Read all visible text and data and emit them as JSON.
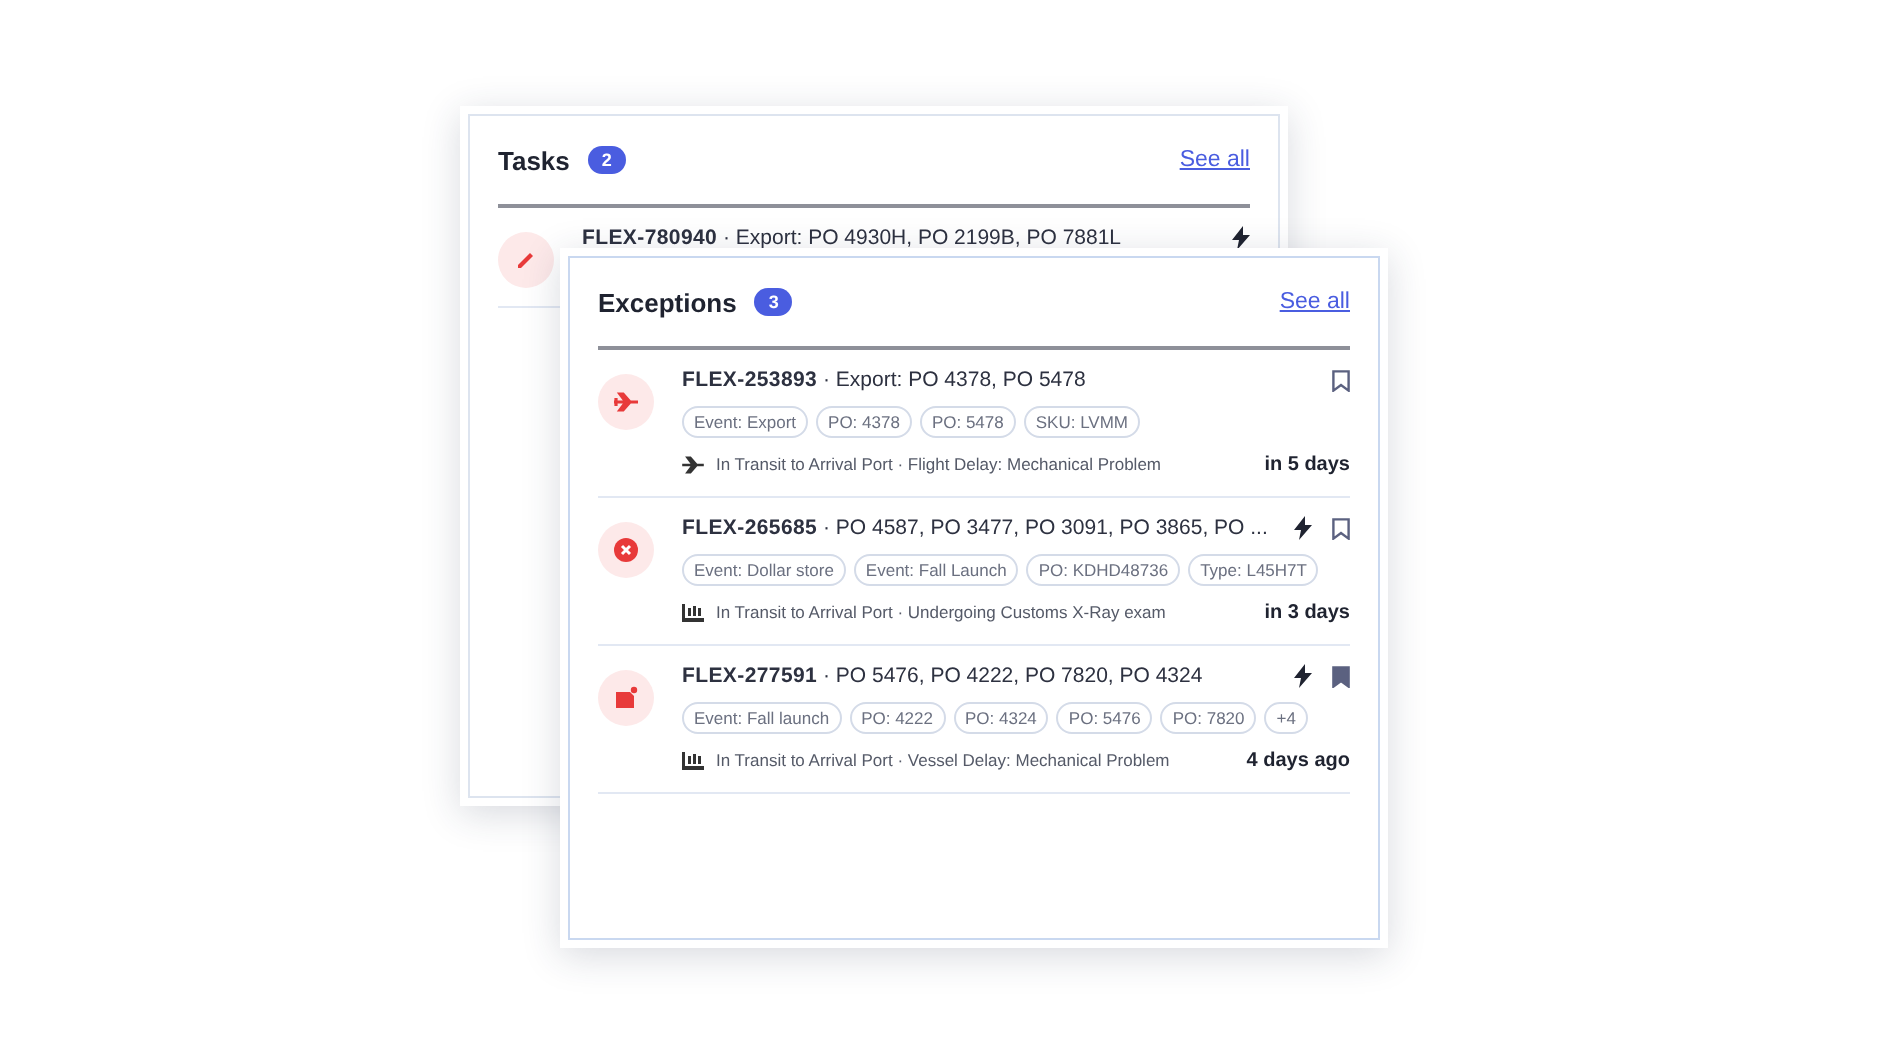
{
  "tasks": {
    "title": "Tasks",
    "count": "2",
    "link": "See all",
    "rows": [
      {
        "kind": "pencil",
        "title": "**FLEX-780940** · Export: PO 4930H, PO 2199B, PO 7881L",
        "urgent": true
      }
    ]
  },
  "exceptions": {
    "title": "Exceptions",
    "count": "3",
    "link": "See all",
    "rows": [
      {
        "kind": "plane",
        "title": "**FLEX-253893** · Export: PO 4378, PO 5478",
        "urgent": false,
        "bookmarked": false,
        "tags": [
          "Event: Export",
          "PO: 4378",
          "PO: 5478",
          "SKU: LVMM"
        ],
        "status": {
          "kind": "flight",
          "text": "In Transit to Arrival Port · Flight Delay: Mechanical Problem"
        },
        "due": "in 5 days"
      },
      {
        "kind": "error",
        "title": "**FLEX-265685** · PO 4587, PO 3477, PO 3091, PO 3865, PO ...",
        "urgent": true,
        "bookmarked": false,
        "tags": [
          "Event: Dollar store",
          "Event: Fall Launch",
          "PO: KDHD48736",
          "Type: L45H7T"
        ],
        "status": {
          "kind": "customs",
          "text": "In Transit to Arrival Port · Undergoing Customs X-Ray exam"
        },
        "due": "in 3 days"
      },
      {
        "kind": "document",
        "title": "**FLEX-277591** · PO 5476, PO 4222, PO 7820, PO 4324",
        "urgent": true,
        "bookmarked": true,
        "tags": [
          "Event: Fall launch",
          "PO: 4222",
          "PO: 4324",
          "PO: 5476",
          "PO: 7820",
          "+4"
        ],
        "status": {
          "kind": "vessel",
          "text": "In Transit to Arrival Port · Vessel Delay: Mechanical Problem"
        },
        "due": "4 days ago"
      }
    ]
  }
}
